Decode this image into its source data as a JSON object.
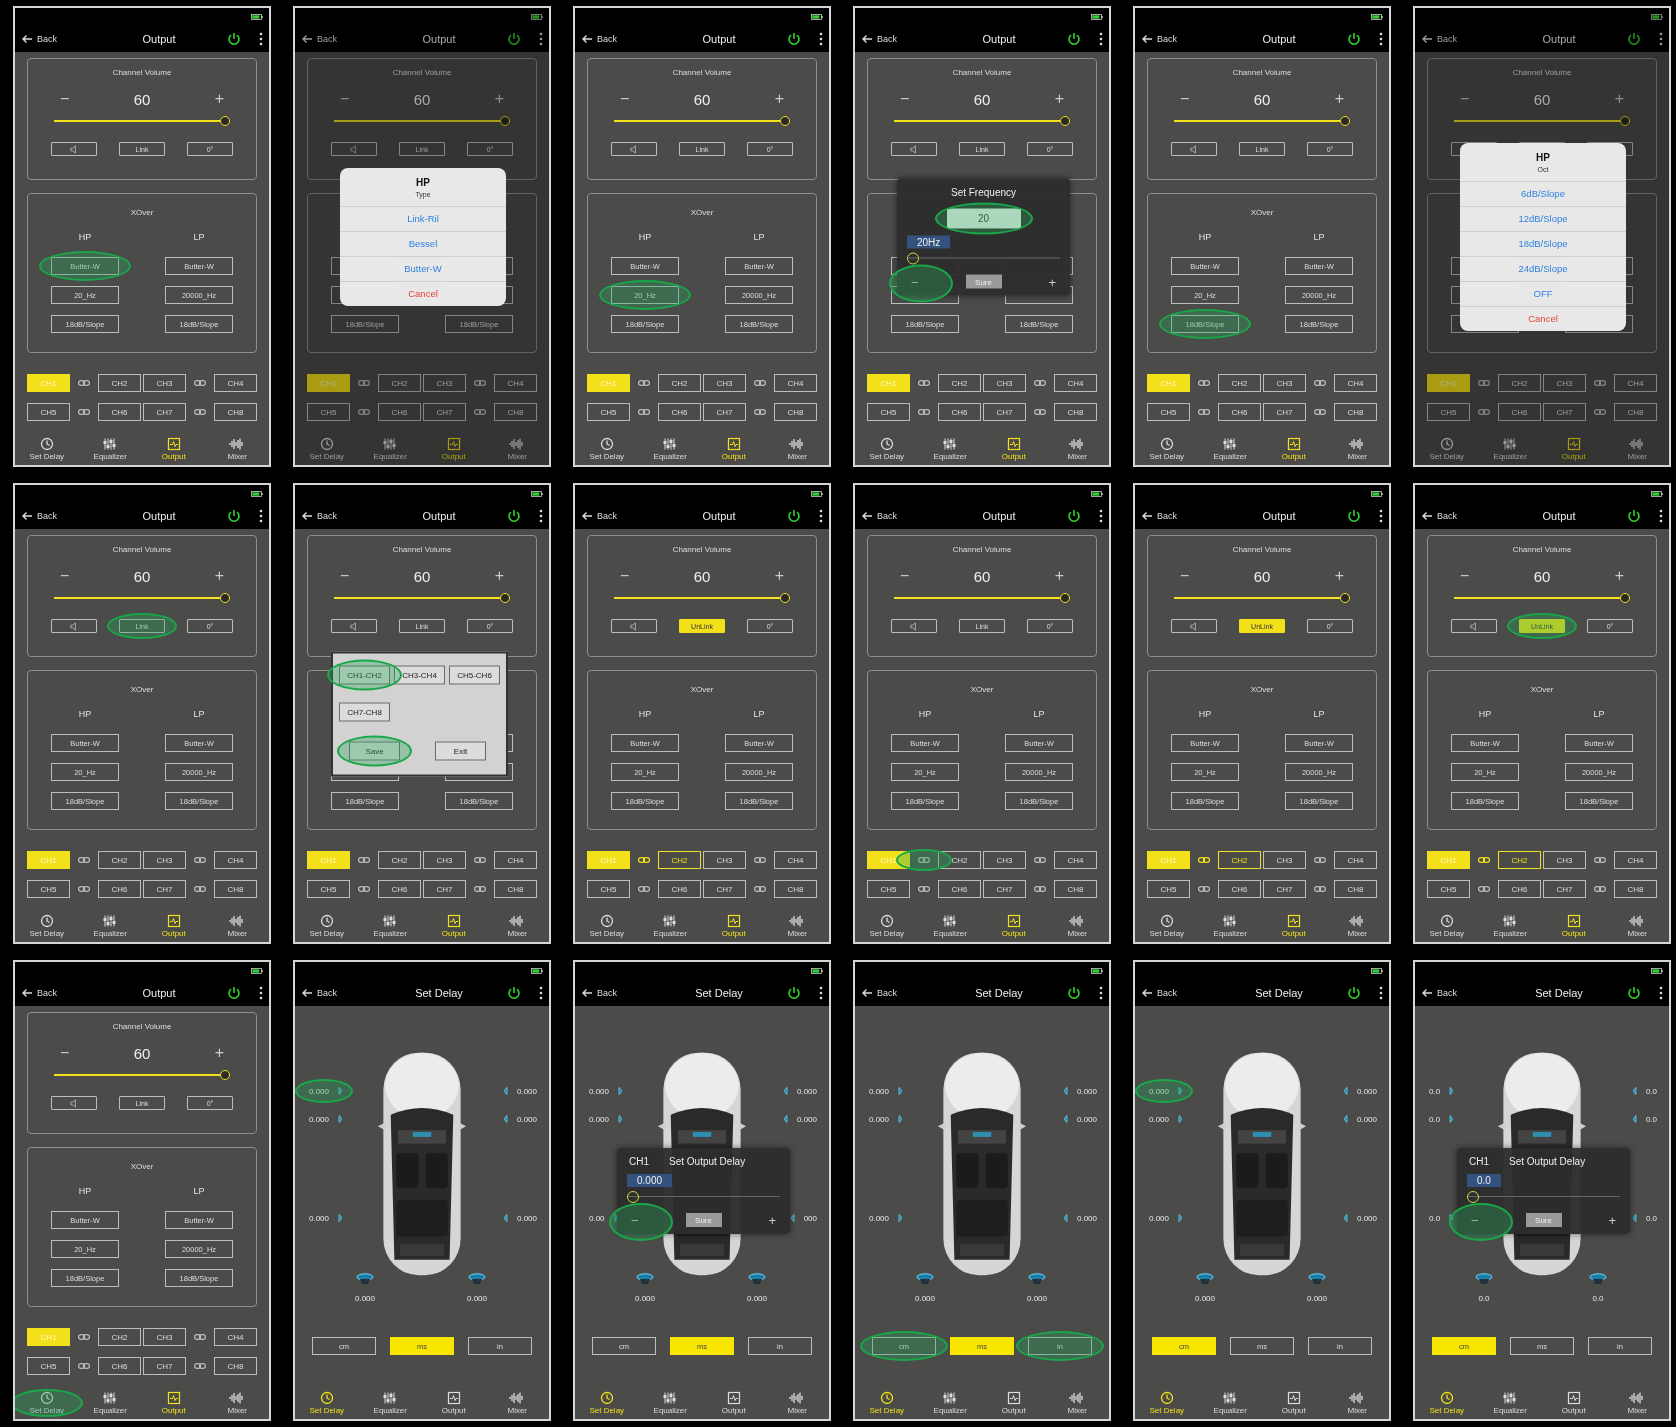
{
  "panels": [
    {
      "kind": "output",
      "back": "Back",
      "title": "Output",
      "volume": {
        "title": "Channel Volume",
        "minus": "−",
        "value": "60",
        "plus": "+",
        "level": 1,
        "link": {
          "label": "Link",
          "on": false
        },
        "phase": "0°"
      },
      "xover": {
        "title": "XOver",
        "hp": {
          "label": "HP",
          "filter": "Butter-W",
          "freq": "20_Hz",
          "slope": "18dB/Slope"
        },
        "lp": {
          "label": "LP",
          "filter": "Butter-W",
          "freq": "20000_Hz",
          "slope": "18dB/Slope"
        }
      },
      "channels": [
        {
          "label": "CH1",
          "selected": true,
          "grouped": false
        },
        {
          "label": "CH2",
          "selected": false,
          "grouped": false
        },
        {
          "label": "CH3",
          "selected": false,
          "grouped": false
        },
        {
          "label": "CH4",
          "selected": false,
          "grouped": false
        },
        {
          "label": "CH5",
          "selected": false,
          "grouped": false
        },
        {
          "label": "CH6",
          "selected": false,
          "grouped": false
        },
        {
          "label": "CH7",
          "selected": false,
          "grouped": false
        },
        {
          "label": "CH8",
          "selected": false,
          "grouped": false
        }
      ],
      "tabs": [
        {
          "label": "Set Delay",
          "selected": false
        },
        {
          "label": "Equalizer",
          "selected": false
        },
        {
          "label": "Output",
          "selected": true
        },
        {
          "label": "Mixer",
          "selected": false
        }
      ],
      "highlights": {
        "hp_filter": true
      }
    },
    {
      "kind": "output",
      "back": "Back",
      "title": "Output",
      "volume": {
        "title": "Channel Volume",
        "minus": "−",
        "value": "60",
        "plus": "+",
        "level": 1,
        "link": {
          "label": "Link",
          "on": false
        },
        "phase": "0°"
      },
      "xover": {
        "hp": {
          "slope": "18dB/Slope"
        },
        "lp": {
          "slope": "18dB/Slope"
        }
      },
      "channels": [
        {
          "label": "CH1",
          "selected": true,
          "grouped": false
        },
        {
          "label": "CH2",
          "selected": false,
          "grouped": false
        },
        {
          "label": "CH3",
          "selected": false,
          "grouped": false
        },
        {
          "label": "CH4",
          "selected": false,
          "grouped": false
        },
        {
          "label": "CH5",
          "selected": false,
          "grouped": false
        },
        {
          "label": "CH6",
          "selected": false,
          "grouped": false
        },
        {
          "label": "CH7",
          "selected": false,
          "grouped": false
        },
        {
          "label": "CH8",
          "selected": false,
          "grouped": false
        }
      ],
      "tabs": [
        {
          "label": "Set Delay",
          "selected": false
        },
        {
          "label": "Equalizer",
          "selected": false
        },
        {
          "label": "Output",
          "selected": true
        },
        {
          "label": "Mixer",
          "selected": false
        }
      ],
      "dialog": {
        "kind": "list",
        "title": "HP",
        "subtitle": "Type",
        "options": [
          {
            "label": "Link-Ril",
            "kind": "option"
          },
          {
            "label": "Bessel",
            "kind": "option"
          },
          {
            "label": "Butter-W",
            "kind": "option"
          },
          {
            "label": "Cancel",
            "kind": "cancel"
          }
        ]
      }
    },
    {
      "kind": "output",
      "back": "Back",
      "title": "Output",
      "volume": {
        "title": "Channel Volume",
        "minus": "−",
        "value": "60",
        "plus": "+",
        "level": 1,
        "link": {
          "label": "Link",
          "on": false
        },
        "phase": "0°"
      },
      "xover": {
        "title": "XOver",
        "hp": {
          "label": "HP",
          "filter": "Butter-W",
          "freq": "20_Hz",
          "slope": "18dB/Slope"
        },
        "lp": {
          "label": "LP",
          "filter": "Butter-W",
          "freq": "20000_Hz",
          "slope": "18dB/Slope"
        }
      },
      "channels": [
        {
          "label": "CH1",
          "selected": true,
          "grouped": false
        },
        {
          "label": "CH2",
          "selected": false,
          "grouped": false
        },
        {
          "label": "CH3",
          "selected": false,
          "grouped": false
        },
        {
          "label": "CH4",
          "selected": false,
          "grouped": false
        },
        {
          "label": "CH5",
          "selected": false,
          "grouped": false
        },
        {
          "label": "CH6",
          "selected": false,
          "grouped": false
        },
        {
          "label": "CH7",
          "selected": false,
          "grouped": false
        },
        {
          "label": "CH8",
          "selected": false,
          "grouped": false
        }
      ],
      "tabs": [
        {
          "label": "Set Delay",
          "selected": false
        },
        {
          "label": "Equalizer",
          "selected": false
        },
        {
          "label": "Output",
          "selected": true
        },
        {
          "label": "Mixer",
          "selected": false
        }
      ],
      "highlights": {
        "hp_freq": true
      }
    },
    {
      "kind": "output",
      "back": "Back",
      "title": "Output",
      "volume": {
        "title": "Channel Volume",
        "minus": "−",
        "value": "60",
        "plus": "+",
        "level": 1,
        "link": {
          "label": "Link",
          "on": false
        },
        "phase": "0°"
      },
      "xover": {
        "hp": {
          "slope": "18dB/Slope"
        },
        "lp": {
          "slope": "18dB/Slope"
        }
      },
      "channels": [
        {
          "label": "CH1",
          "selected": true,
          "grouped": false
        },
        {
          "label": "CH2",
          "selected": false,
          "grouped": false
        },
        {
          "label": "CH3",
          "selected": false,
          "grouped": false
        },
        {
          "label": "CH4",
          "selected": false,
          "grouped": false
        },
        {
          "label": "CH5",
          "selected": false,
          "grouped": false
        },
        {
          "label": "CH6",
          "selected": false,
          "grouped": false
        },
        {
          "label": "CH7",
          "selected": false,
          "grouped": false
        },
        {
          "label": "CH8",
          "selected": false,
          "grouped": false
        }
      ],
      "tabs": [
        {
          "label": "Set Delay",
          "selected": false
        },
        {
          "label": "Equalizer",
          "selected": false
        },
        {
          "label": "Output",
          "selected": true
        },
        {
          "label": "Mixer",
          "selected": false
        }
      ],
      "dialog": {
        "kind": "slider",
        "title": "Set Frequency",
        "value": "20",
        "bubble": "20Hz",
        "level": 0,
        "minus": "−",
        "confirm": "Sure",
        "plus": "+"
      },
      "highlights": {
        "dialog_value": true,
        "dialog_thumb": true
      }
    },
    {
      "kind": "output",
      "back": "Back",
      "title": "Output",
      "volume": {
        "title": "Channel Volume",
        "minus": "−",
        "value": "60",
        "plus": "+",
        "level": 1,
        "link": {
          "label": "Link",
          "on": false
        },
        "phase": "0°"
      },
      "xover": {
        "title": "XOver",
        "hp": {
          "label": "HP",
          "filter": "Butter-W",
          "freq": "20_Hz",
          "slope": "18dB/Slope"
        },
        "lp": {
          "label": "LP",
          "filter": "Butter-W",
          "freq": "20000_Hz",
          "slope": "18dB/Slope"
        }
      },
      "channels": [
        {
          "label": "CH1",
          "selected": true,
          "grouped": false
        },
        {
          "label": "CH2",
          "selected": false,
          "grouped": false
        },
        {
          "label": "CH3",
          "selected": false,
          "grouped": false
        },
        {
          "label": "CH4",
          "selected": false,
          "grouped": false
        },
        {
          "label": "CH5",
          "selected": false,
          "grouped": false
        },
        {
          "label": "CH6",
          "selected": false,
          "grouped": false
        },
        {
          "label": "CH7",
          "selected": false,
          "grouped": false
        },
        {
          "label": "CH8",
          "selected": false,
          "grouped": false
        }
      ],
      "tabs": [
        {
          "label": "Set Delay",
          "selected": false
        },
        {
          "label": "Equalizer",
          "selected": false
        },
        {
          "label": "Output",
          "selected": true
        },
        {
          "label": "Mixer",
          "selected": false
        }
      ],
      "highlights": {
        "hp_slope": true
      }
    },
    {
      "kind": "output",
      "back": "Back",
      "title": "Output",
      "volume": {
        "title": "Channel Volume",
        "minus": "−",
        "value": "60",
        "plus": "+",
        "level": 1
      },
      "channels": [
        {
          "label": "CH1",
          "selected": true,
          "grouped": false
        },
        {
          "label": "CH2",
          "selected": false,
          "grouped": false
        },
        {
          "label": "CH3",
          "selected": false,
          "grouped": false
        },
        {
          "label": "CH4",
          "selected": false,
          "grouped": false
        },
        {
          "label": "CH5",
          "selected": false,
          "grouped": false
        },
        {
          "label": "CH6",
          "selected": false,
          "grouped": false
        },
        {
          "label": "CH7",
          "selected": false,
          "grouped": false
        },
        {
          "label": "CH8",
          "selected": false,
          "grouped": false
        }
      ],
      "tabs": [
        {
          "label": "Set Delay",
          "selected": false
        },
        {
          "label": "Equalizer",
          "selected": false
        },
        {
          "label": "Output",
          "selected": true
        },
        {
          "label": "Mixer",
          "selected": false
        }
      ],
      "dialog": {
        "kind": "list",
        "title": "HP",
        "subtitle": "Oct",
        "options": [
          {
            "label": "6dB/Slope",
            "kind": "option"
          },
          {
            "label": "12dB/Slope",
            "kind": "option"
          },
          {
            "label": "18dB/Slope",
            "kind": "option"
          },
          {
            "label": "24dB/Slope",
            "kind": "option"
          },
          {
            "label": "OFF",
            "kind": "option"
          },
          {
            "label": "Cancel",
            "kind": "cancel"
          }
        ]
      }
    },
    {
      "kind": "output",
      "back": "Back",
      "title": "Output",
      "volume": {
        "title": "Channel Volume",
        "minus": "−",
        "value": "60",
        "plus": "+",
        "level": 1,
        "link": {
          "label": "Link",
          "on": false
        },
        "phase": "0°"
      },
      "xover": {
        "title": "XOver",
        "hp": {
          "label": "HP",
          "filter": "Butter-W",
          "freq": "20_Hz",
          "slope": "18dB/Slope"
        },
        "lp": {
          "label": "LP",
          "filter": "Butter-W",
          "freq": "20000_Hz",
          "slope": "18dB/Slope"
        }
      },
      "channels": [
        {
          "label": "CH1",
          "selected": true,
          "grouped": false
        },
        {
          "label": "CH2",
          "selected": false,
          "grouped": false
        },
        {
          "label": "CH3",
          "selected": false,
          "grouped": false
        },
        {
          "label": "CH4",
          "selected": false,
          "grouped": false
        },
        {
          "label": "CH5",
          "selected": false,
          "grouped": false
        },
        {
          "label": "CH6",
          "selected": false,
          "grouped": false
        },
        {
          "label": "CH7",
          "selected": false,
          "grouped": false
        },
        {
          "label": "CH8",
          "selected": false,
          "grouped": false
        }
      ],
      "tabs": [
        {
          "label": "Set Delay",
          "selected": false
        },
        {
          "label": "Equalizer",
          "selected": false
        },
        {
          "label": "Output",
          "selected": true
        },
        {
          "label": "Mixer",
          "selected": false
        }
      ],
      "highlights": {
        "link_button": true
      }
    },
    {
      "kind": "output",
      "back": "Back",
      "title": "Output",
      "volume": {
        "title": "Channel Volume",
        "minus": "−",
        "value": "60",
        "plus": "+",
        "level": 1,
        "link": {
          "label": "Link",
          "on": false
        },
        "phase": "0°"
      },
      "xover": {
        "hp": {
          "slope": "18dB/Slope"
        },
        "lp": {
          "slope": "18dB/Slope"
        }
      },
      "channels": [
        {
          "label": "CH1",
          "selected": true,
          "grouped": false
        },
        {
          "label": "CH2",
          "selected": false,
          "grouped": false
        },
        {
          "label": "CH3",
          "selected": false,
          "grouped": false
        },
        {
          "label": "CH4",
          "selected": false,
          "grouped": false
        },
        {
          "label": "CH5",
          "selected": false,
          "grouped": false
        },
        {
          "label": "CH6",
          "selected": false,
          "grouped": false
        },
        {
          "label": "CH7",
          "selected": false,
          "grouped": false
        },
        {
          "label": "CH8",
          "selected": false,
          "grouped": false
        }
      ],
      "tabs": [
        {
          "label": "Set Delay",
          "selected": false
        },
        {
          "label": "Equalizer",
          "selected": false
        },
        {
          "label": "Output",
          "selected": true
        },
        {
          "label": "Mixer",
          "selected": false
        }
      ],
      "dialog": {
        "kind": "group",
        "options": [
          "CH1-CH2",
          "CH3-CH4",
          "CH5-CH6",
          "CH7-CH8"
        ],
        "save": "Save",
        "exit": "Exit"
      },
      "highlights": {
        "dialog_option0": true,
        "dialog_save": true
      }
    },
    {
      "kind": "output",
      "back": "Back",
      "title": "Output",
      "volume": {
        "title": "Channel Volume",
        "minus": "−",
        "value": "60",
        "plus": "+",
        "level": 1,
        "link": {
          "label": "UnLink",
          "on": true
        },
        "phase": "0°"
      },
      "xover": {
        "title": "XOver",
        "hp": {
          "label": "HP",
          "filter": "Butter-W",
          "freq": "20_Hz",
          "slope": "18dB/Slope"
        },
        "lp": {
          "label": "LP",
          "filter": "Butter-W",
          "freq": "20000_Hz",
          "slope": "18dB/Slope"
        }
      },
      "channels": [
        {
          "label": "CH1",
          "selected": true,
          "grouped": false
        },
        {
          "label": "CH2",
          "selected": false,
          "grouped": true
        },
        {
          "label": "CH3",
          "selected": false,
          "grouped": false
        },
        {
          "label": "CH4",
          "selected": false,
          "grouped": false
        },
        {
          "label": "CH5",
          "selected": false,
          "grouped": false
        },
        {
          "label": "CH6",
          "selected": false,
          "grouped": false
        },
        {
          "label": "CH7",
          "selected": false,
          "grouped": false
        },
        {
          "label": "CH8",
          "selected": false,
          "grouped": false
        }
      ],
      "tabs": [
        {
          "label": "Set Delay",
          "selected": false
        },
        {
          "label": "Equalizer",
          "selected": false
        },
        {
          "label": "Output",
          "selected": true
        },
        {
          "label": "Mixer",
          "selected": false
        }
      ]
    },
    {
      "kind": "output",
      "back": "Back",
      "title": "Output",
      "volume": {
        "title": "Channel Volume",
        "minus": "−",
        "value": "60",
        "plus": "+",
        "level": 1,
        "link": {
          "label": "Link",
          "on": false
        },
        "phase": "0°"
      },
      "xover": {
        "title": "XOver",
        "hp": {
          "label": "HP",
          "filter": "Butter-W",
          "freq": "20_Hz",
          "slope": "18dB/Slope"
        },
        "lp": {
          "label": "LP",
          "filter": "Butter-W",
          "freq": "20000_Hz",
          "slope": "18dB/Slope"
        }
      },
      "channels": [
        {
          "label": "CH1",
          "selected": true,
          "grouped": false
        },
        {
          "label": "CH2",
          "selected": false,
          "grouped": false
        },
        {
          "label": "CH3",
          "selected": false,
          "grouped": false
        },
        {
          "label": "CH4",
          "selected": false,
          "grouped": false
        },
        {
          "label": "CH5",
          "selected": false,
          "grouped": false
        },
        {
          "label": "CH6",
          "selected": false,
          "grouped": false
        },
        {
          "label": "CH7",
          "selected": false,
          "grouped": false
        },
        {
          "label": "CH8",
          "selected": false,
          "grouped": false
        }
      ],
      "tabs": [
        {
          "label": "Set Delay",
          "selected": false
        },
        {
          "label": "Equalizer",
          "selected": false
        },
        {
          "label": "Output",
          "selected": true
        },
        {
          "label": "Mixer",
          "selected": false
        }
      ],
      "highlights": {
        "pair0_link": true
      }
    },
    {
      "kind": "output",
      "back": "Back",
      "title": "Output",
      "volume": {
        "title": "Channel Volume",
        "minus": "−",
        "value": "60",
        "plus": "+",
        "level": 1,
        "link": {
          "label": "UnLink",
          "on": true
        },
        "phase": "0°"
      },
      "xover": {
        "title": "XOver",
        "hp": {
          "label": "HP",
          "filter": "Butter-W",
          "freq": "20_Hz",
          "slope": "18dB/Slope"
        },
        "lp": {
          "label": "LP",
          "filter": "Butter-W",
          "freq": "20000_Hz",
          "slope": "18dB/Slope"
        }
      },
      "channels": [
        {
          "label": "CH1",
          "selected": true,
          "grouped": false
        },
        {
          "label": "CH2",
          "selected": false,
          "grouped": true
        },
        {
          "label": "CH3",
          "selected": false,
          "grouped": false
        },
        {
          "label": "CH4",
          "selected": false,
          "grouped": false
        },
        {
          "label": "CH5",
          "selected": false,
          "grouped": false
        },
        {
          "label": "CH6",
          "selected": false,
          "grouped": false
        },
        {
          "label": "CH7",
          "selected": false,
          "grouped": false
        },
        {
          "label": "CH8",
          "selected": false,
          "grouped": false
        }
      ],
      "tabs": [
        {
          "label": "Set Delay",
          "selected": false
        },
        {
          "label": "Equalizer",
          "selected": false
        },
        {
          "label": "Output",
          "selected": true
        },
        {
          "label": "Mixer",
          "selected": false
        }
      ]
    },
    {
      "kind": "output",
      "back": "Back",
      "title": "Output",
      "volume": {
        "title": "Channel Volume",
        "minus": "−",
        "value": "60",
        "plus": "+",
        "level": 1,
        "link": {
          "label": "UnLink",
          "on": true
        },
        "phase": "0°"
      },
      "xover": {
        "title": "XOver",
        "hp": {
          "label": "HP",
          "filter": "Butter-W",
          "freq": "20_Hz",
          "slope": "18dB/Slope"
        },
        "lp": {
          "label": "LP",
          "filter": "Butter-W",
          "freq": "20000_Hz",
          "slope": "18dB/Slope"
        }
      },
      "channels": [
        {
          "label": "CH1",
          "selected": true,
          "grouped": false
        },
        {
          "label": "CH2",
          "selected": false,
          "grouped": true
        },
        {
          "label": "CH3",
          "selected": false,
          "grouped": false
        },
        {
          "label": "CH4",
          "selected": false,
          "grouped": false
        },
        {
          "label": "CH5",
          "selected": false,
          "grouped": false
        },
        {
          "label": "CH6",
          "selected": false,
          "grouped": false
        },
        {
          "label": "CH7",
          "selected": false,
          "grouped": false
        },
        {
          "label": "CH8",
          "selected": false,
          "grouped": false
        }
      ],
      "tabs": [
        {
          "label": "Set Delay",
          "selected": false
        },
        {
          "label": "Equalizer",
          "selected": false
        },
        {
          "label": "Output",
          "selected": true
        },
        {
          "label": "Mixer",
          "selected": false
        }
      ],
      "highlights": {
        "link_button": true
      }
    },
    {
      "kind": "output",
      "back": "Back",
      "title": "Output",
      "volume": {
        "title": "Channel Volume",
        "minus": "−",
        "value": "60",
        "plus": "+",
        "level": 1,
        "link": {
          "label": "Link",
          "on": false
        },
        "phase": "0°"
      },
      "xover": {
        "title": "XOver",
        "hp": {
          "label": "HP",
          "filter": "Butter-W",
          "freq": "20_Hz",
          "slope": "18dB/Slope"
        },
        "lp": {
          "label": "LP",
          "filter": "Butter-W",
          "freq": "20000_Hz",
          "slope": "18dB/Slope"
        }
      },
      "channels": [
        {
          "label": "CH1",
          "selected": true,
          "grouped": false
        },
        {
          "label": "CH2",
          "selected": false,
          "grouped": false
        },
        {
          "label": "CH3",
          "selected": false,
          "grouped": false
        },
        {
          "label": "CH4",
          "selected": false,
          "grouped": false
        },
        {
          "label": "CH5",
          "selected": false,
          "grouped": false
        },
        {
          "label": "CH6",
          "selected": false,
          "grouped": false
        },
        {
          "label": "CH7",
          "selected": false,
          "grouped": false
        },
        {
          "label": "CH8",
          "selected": false,
          "grouped": false
        }
      ],
      "tabs": [
        {
          "label": "Set Delay",
          "selected": false
        },
        {
          "label": "Equalizer",
          "selected": false
        },
        {
          "label": "Output",
          "selected": true
        },
        {
          "label": "Mixer",
          "selected": false
        }
      ],
      "highlights": {
        "tab0": true
      }
    },
    {
      "kind": "delay",
      "back": "Back",
      "title": "Set Delay",
      "speakers": [
        {
          "value": "0.000"
        },
        {
          "value": "0.000"
        },
        {
          "value": "0.000"
        },
        {
          "value": "0.000"
        },
        {
          "value": "0.000"
        },
        {
          "value": "0.000"
        },
        {
          "value": "0.000"
        },
        {
          "value": "0.000"
        }
      ],
      "units": [
        {
          "label": "cm",
          "selected": false
        },
        {
          "label": "ms",
          "selected": true
        },
        {
          "label": "in",
          "selected": false
        }
      ],
      "tabs": [
        {
          "label": "Set Delay",
          "selected": true
        },
        {
          "label": "Equalizer",
          "selected": false
        },
        {
          "label": "Output",
          "selected": false
        },
        {
          "label": "Mixer",
          "selected": false
        }
      ],
      "highlights": {
        "value0": true
      }
    },
    {
      "kind": "delay",
      "back": "Back",
      "title": "Set Delay",
      "speakers": [
        {
          "value": "0.000"
        },
        {
          "value": "0.000"
        },
        {
          "value": "0.000"
        },
        {
          "value": "0.000"
        },
        {
          "value": "0.00"
        },
        {
          "value": "000"
        },
        {
          "value": "0.000"
        },
        {
          "value": "0.000"
        }
      ],
      "units": [
        {
          "label": "cm",
          "selected": false
        },
        {
          "label": "ms",
          "selected": true
        },
        {
          "label": "in",
          "selected": false
        }
      ],
      "tabs": [
        {
          "label": "Set Delay",
          "selected": true
        },
        {
          "label": "Equalizer",
          "selected": false
        },
        {
          "label": "Output",
          "selected": false
        },
        {
          "label": "Mixer",
          "selected": false
        }
      ],
      "dialog": {
        "kind": "slider",
        "channel": "CH1",
        "title": "Set Output Delay",
        "bubble": "0.000",
        "level": 0,
        "minus": "−",
        "confirm": "Sure",
        "plus": "+"
      },
      "highlights": {
        "dialog_thumb": true
      }
    },
    {
      "kind": "delay",
      "back": "Back",
      "title": "Set Delay",
      "speakers": [
        {
          "value": "0.000"
        },
        {
          "value": "0.000"
        },
        {
          "value": "0.000"
        },
        {
          "value": "0.000"
        },
        {
          "value": "0.000"
        },
        {
          "value": "0.000"
        },
        {
          "value": "0.000"
        },
        {
          "value": "0.000"
        }
      ],
      "units": [
        {
          "label": "cm",
          "selected": false
        },
        {
          "label": "ms",
          "selected": true
        },
        {
          "label": "in",
          "selected": false
        }
      ],
      "tabs": [
        {
          "label": "Set Delay",
          "selected": true
        },
        {
          "label": "Equalizer",
          "selected": false
        },
        {
          "label": "Output",
          "selected": false
        },
        {
          "label": "Mixer",
          "selected": false
        }
      ],
      "highlights": {
        "unit0": true,
        "unit2": true
      }
    },
    {
      "kind": "delay",
      "back": "Back",
      "title": "Set Delay",
      "speakers": [
        {
          "value": "0.000"
        },
        {
          "value": "0.000"
        },
        {
          "value": "0.000"
        },
        {
          "value": "0.000"
        },
        {
          "value": "0.000"
        },
        {
          "value": "0.000"
        },
        {
          "value": "0.000"
        },
        {
          "value": "0.000"
        }
      ],
      "units": [
        {
          "label": "cm",
          "selected": true
        },
        {
          "label": "ms",
          "selected": false
        },
        {
          "label": "in",
          "selected": false
        }
      ],
      "tabs": [
        {
          "label": "Set Delay",
          "selected": true
        },
        {
          "label": "Equalizer",
          "selected": false
        },
        {
          "label": "Output",
          "selected": false
        },
        {
          "label": "Mixer",
          "selected": false
        }
      ],
      "highlights": {
        "value0": true
      }
    },
    {
      "kind": "delay",
      "back": "Back",
      "title": "Set Delay",
      "speakers": [
        {
          "value": "0.0"
        },
        {
          "value": "0.0"
        },
        {
          "value": "0.0"
        },
        {
          "value": "0.0"
        },
        {
          "value": "0.0"
        },
        {
          "value": "0.0"
        },
        {
          "value": "0.0"
        },
        {
          "value": "0.0"
        }
      ],
      "units": [
        {
          "label": "cm",
          "selected": true
        },
        {
          "label": "ms",
          "selected": false
        },
        {
          "label": "in",
          "selected": false
        }
      ],
      "tabs": [
        {
          "label": "Set Delay",
          "selected": true
        },
        {
          "label": "Equalizer",
          "selected": false
        },
        {
          "label": "Output",
          "selected": false
        },
        {
          "label": "Mixer",
          "selected": false
        }
      ],
      "dialog": {
        "kind": "slider",
        "channel": "CH1",
        "title": "Set Output Delay",
        "bubble": "0.0",
        "level": 0,
        "minus": "−",
        "confirm": "Sure",
        "plus": "+"
      },
      "highlights": {
        "dialog_thumb": true
      }
    }
  ]
}
